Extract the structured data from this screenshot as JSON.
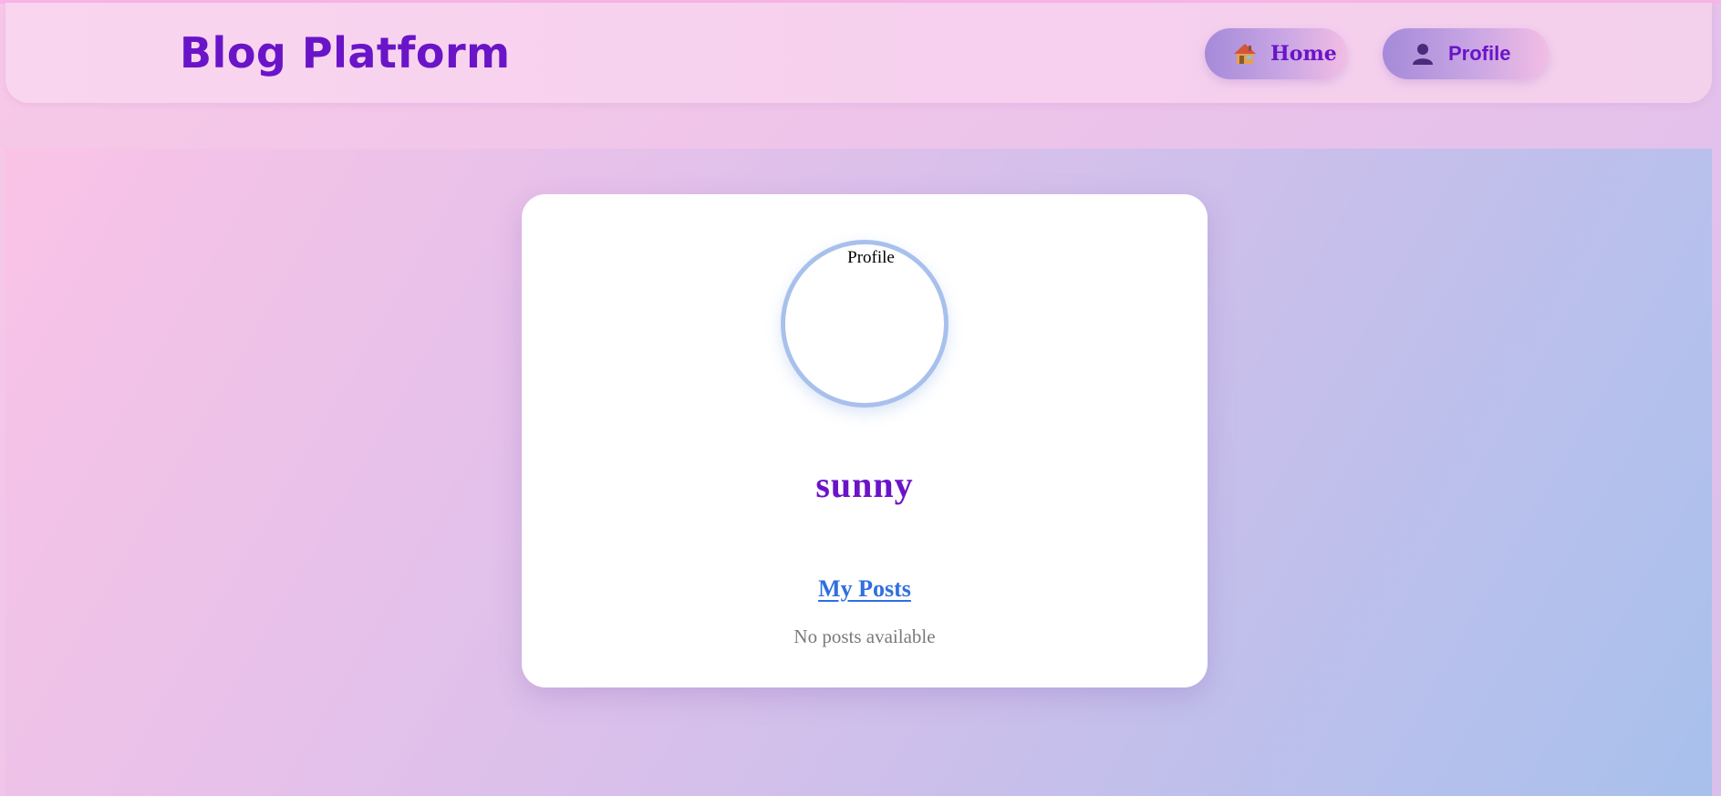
{
  "header": {
    "brand": "Blog Platform",
    "nav": {
      "home_label": "Home",
      "home_icon": "house-icon",
      "profile_label": "Profile",
      "profile_icon": "user-silhouette-icon"
    }
  },
  "profile": {
    "avatar_alt": "Profile",
    "username": "sunny",
    "posts_heading": "My Posts",
    "empty_message": "No posts available"
  },
  "colors": {
    "brand_purple": "#6a14c8",
    "link_blue": "#2f6fe0",
    "avatar_ring": "#a8c0ec",
    "muted_text": "#7a7a7a"
  }
}
